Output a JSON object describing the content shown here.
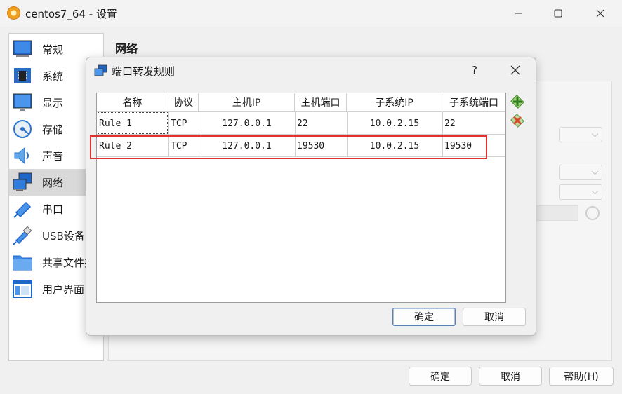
{
  "window": {
    "title": "centos7_64 - 设置",
    "controls": [
      "minimize-icon",
      "maximize-icon",
      "close-icon"
    ]
  },
  "sidebar": {
    "items": [
      {
        "label": "常规",
        "icon": "general-icon",
        "active": false
      },
      {
        "label": "系统",
        "icon": "chip-icon",
        "active": false
      },
      {
        "label": "显示",
        "icon": "monitor-icon",
        "active": false
      },
      {
        "label": "存储",
        "icon": "disk-icon",
        "active": false
      },
      {
        "label": "声音",
        "icon": "speaker-icon",
        "active": false
      },
      {
        "label": "网络",
        "icon": "network-icon",
        "active": true
      },
      {
        "label": "串口",
        "icon": "serial-port-icon",
        "active": false
      },
      {
        "label": "USB设备",
        "icon": "usb-icon",
        "active": false
      },
      {
        "label": "共享文件夹",
        "icon": "folder-icon",
        "active": false
      },
      {
        "label": "用户界面",
        "icon": "ui-icon",
        "active": false
      }
    ]
  },
  "section": {
    "title": "网络"
  },
  "main_buttons": {
    "ok": "确定",
    "cancel": "取消",
    "help": "帮助(H)"
  },
  "dialog": {
    "title": "端口转发规则",
    "help_label": "?",
    "columns": [
      "名称",
      "协议",
      "主机IP",
      "主机端口",
      "子系统IP",
      "子系统端口"
    ],
    "rows": [
      {
        "name": "Rule 1",
        "protocol": "TCP",
        "host_ip": "127.0.0.1",
        "host_port": "22",
        "guest_ip": "10.0.2.15",
        "guest_port": "22"
      },
      {
        "name": "Rule 2",
        "protocol": "TCP",
        "host_ip": "127.0.0.1",
        "host_port": "19530",
        "guest_ip": "10.0.2.15",
        "guest_port": "19530"
      }
    ],
    "ok_label": "确定",
    "cancel_label": "取消",
    "tools": [
      "add-rule-icon",
      "remove-rule-icon"
    ]
  },
  "colors": {
    "highlight": "#e03030",
    "selected_sidebar": "#d9d9d9",
    "accent_blue": "#2a72c8"
  }
}
